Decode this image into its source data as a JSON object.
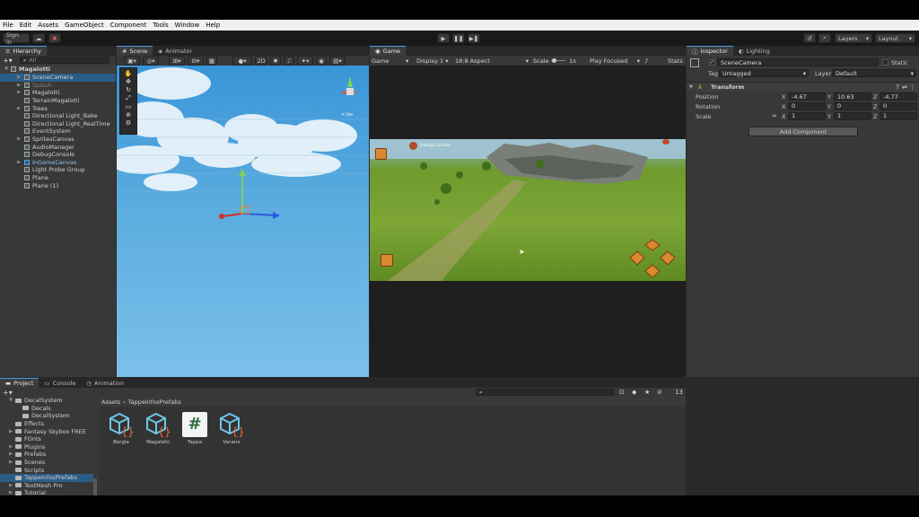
{
  "menu": [
    "File",
    "Edit",
    "Assets",
    "GameObject",
    "Component",
    "Tools",
    "Window",
    "Help"
  ],
  "toolbar": {
    "sign_in": "Sign in",
    "layers": "Layers",
    "layout": "Layout"
  },
  "hierarchy": {
    "tab": "Hierarchy",
    "search_placeholder": "All",
    "root": "Magalotti",
    "items": [
      "SceneCamera",
      "Splash",
      "Magalotti",
      "TerrainMagalotti",
      "Trees",
      "Directional Light_Bake",
      "Directional Light_RealTime",
      "EventSystem",
      "SpritesCanvas",
      "AudioManager",
      "DebugConsole",
      "InGameCanvas",
      "Light Probe Group",
      "Plane",
      "Plane (1)"
    ]
  },
  "scene": {
    "tabs": [
      "Scene",
      "Animator"
    ],
    "btn_2d": "2D",
    "persp": "< Iso"
  },
  "game": {
    "tab": "Game",
    "display_mode": "Game",
    "display": "Display 1",
    "aspect": "18:8 Aspect",
    "scale_label": "Scale",
    "scale_value": "1x",
    "play_focused": "Play Focused",
    "stats": "Stats",
    "debug_console": "Debug Console"
  },
  "inspector": {
    "tabs": [
      "Inspector",
      "Lighting"
    ],
    "object_name": "SceneCamera",
    "static": "Static",
    "tag_label": "Tag",
    "tag_value": "Untagged",
    "layer_label": "Layer",
    "layer_value": "Default",
    "component": "Transform",
    "position": {
      "label": "Position",
      "x": "-4.67",
      "y": "10.63",
      "z": "-4.77"
    },
    "rotation": {
      "label": "Rotation",
      "x": "0",
      "y": "0",
      "z": "0"
    },
    "scale": {
      "label": "Scale",
      "x": "1",
      "y": "1",
      "z": "1"
    },
    "add_component": "Add Component"
  },
  "bottom": {
    "tabs": [
      "Project",
      "Console",
      "Animation"
    ],
    "count": "13",
    "breadcrumb_root": "Assets",
    "breadcrumb_current": "TappeInfosPrefabs"
  },
  "project_tree": [
    "DecalSystem",
    "Decals",
    "DecalSystem",
    "Effects",
    "Fantasy Skybox FREE",
    "FOnts",
    "Plugins",
    "Prefabs",
    "Scenes",
    "Scripts",
    "TappeInfosPrefabs",
    "TextMesh Pro",
    "Tutorial",
    "UI",
    "Packages"
  ],
  "assets": [
    {
      "name": "Borgia",
      "kind": "prefab"
    },
    {
      "name": "Magalotti",
      "kind": "prefab"
    },
    {
      "name": "Tappa",
      "kind": "script"
    },
    {
      "name": "Varano",
      "kind": "prefab"
    }
  ],
  "colors": {
    "accent": "#4a9af0",
    "selection": "#2c5d87",
    "sky": "#5aacdf",
    "grass": "#6f9a2c"
  }
}
